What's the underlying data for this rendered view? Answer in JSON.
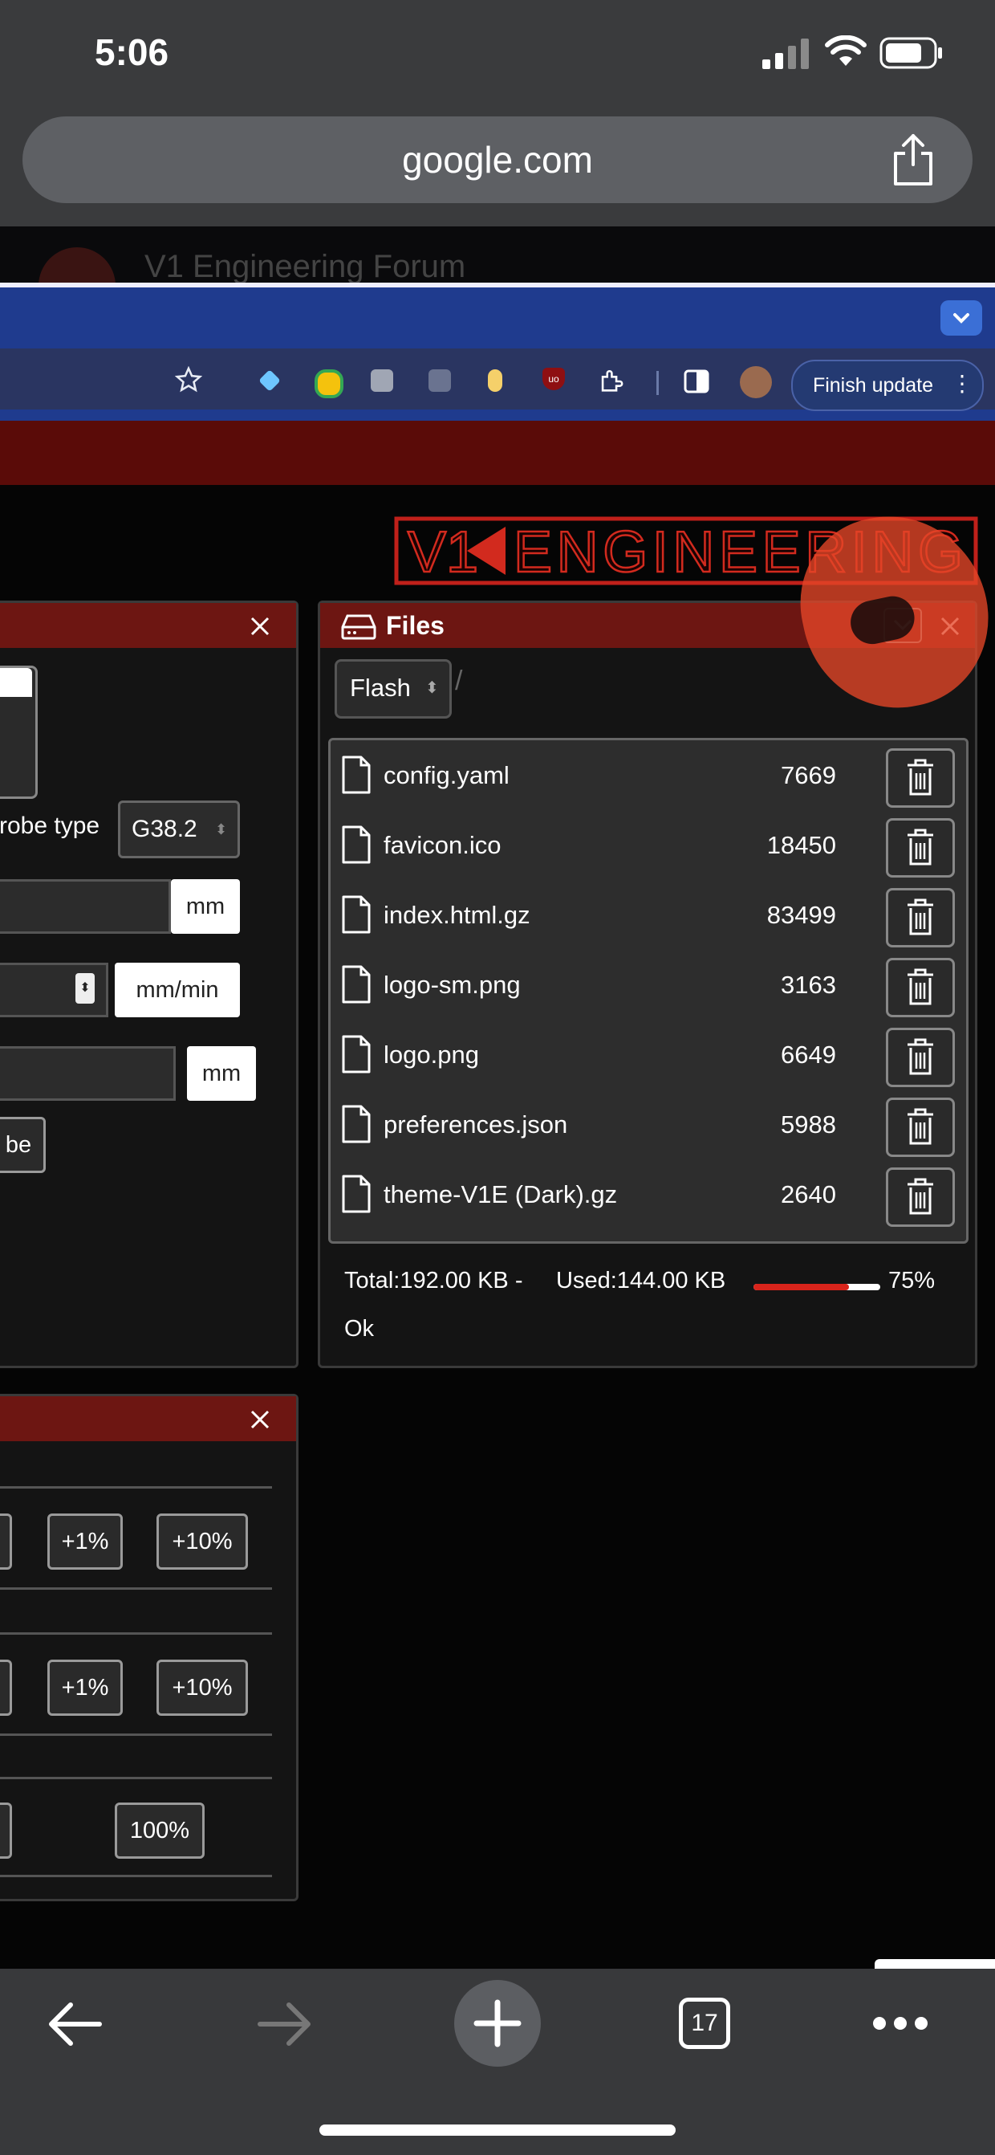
{
  "status_bar": {
    "time": "5:06"
  },
  "safari": {
    "url": "google.com",
    "background_tab_title": "V1 Engineering Forum",
    "tab_count": "17"
  },
  "browser": {
    "finish_update_label": "Finish update",
    "menu_glyph": "⋮",
    "extension_badge": "uo"
  },
  "brand": {
    "logo_text": "V1ENGINEERING",
    "accent": "#d8241b",
    "header_color": "#6d1612"
  },
  "files_panel": {
    "title": "Files",
    "filesystem": "Flash",
    "path": "/",
    "files": [
      {
        "name": "config.yaml",
        "size": "7669"
      },
      {
        "name": "favicon.ico",
        "size": "18450"
      },
      {
        "name": "index.html.gz",
        "size": "83499"
      },
      {
        "name": "logo-sm.png",
        "size": "3163"
      },
      {
        "name": "logo.png",
        "size": "6649"
      },
      {
        "name": "preferences.json",
        "size": "5988"
      },
      {
        "name": "theme-V1E (Dark).gz",
        "size": "2640"
      }
    ],
    "total": "Total:192.00 KB -",
    "used": "Used:144.00 KB",
    "used_percent": "75%",
    "used_fraction": 0.75,
    "status": "Ok"
  },
  "probe_panel": {
    "probe_type_label": "robe type",
    "probe_type_value": "G38.2",
    "unit_mm": "mm",
    "unit_mm_min": "mm/min",
    "unit_mm_2": "mm",
    "probe_button": "be"
  },
  "override_panel": {
    "row1": [
      "+1%",
      "+10%"
    ],
    "row2": [
      "+1%",
      "+10%"
    ],
    "reset": "100%"
  },
  "icons": [
    "share-icon",
    "star-icon",
    "drive-icon",
    "file-icon",
    "trash-icon",
    "chevron-down-icon",
    "close-icon",
    "back-arrow-icon",
    "forward-arrow-icon",
    "plus-icon",
    "tabs-icon",
    "more-icon"
  ]
}
